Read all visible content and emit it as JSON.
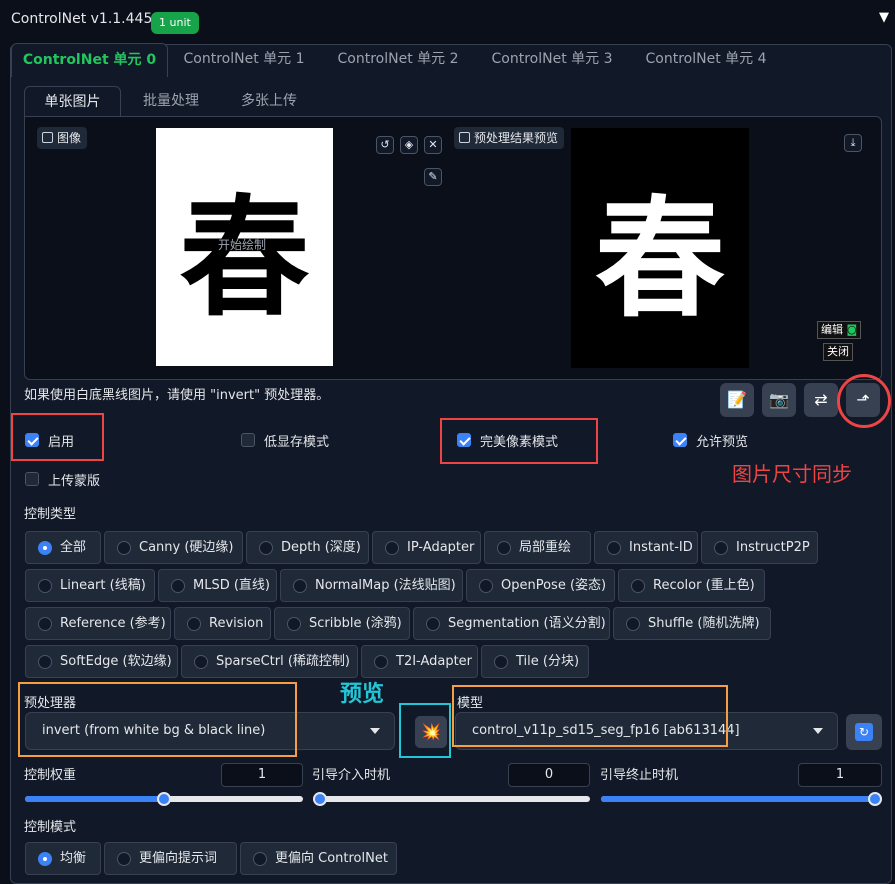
{
  "header": {
    "title": "ControlNet v1.1.445",
    "badge": "1 unit",
    "collapse_icon": "▼"
  },
  "unit_tabs": [
    "ControlNet 单元 0",
    "ControlNet 单元 1",
    "ControlNet 单元 2",
    "ControlNet 单元 3",
    "ControlNet 单元 4"
  ],
  "image_tabs": [
    "单张图片",
    "批量处理",
    "多张上传"
  ],
  "image_panel": {
    "input_label": "图像",
    "canvas_hint": "开始绘制",
    "glyph": "春",
    "preview_label": "预处理结果预览",
    "edit_button": "编辑",
    "close_button": "关闭"
  },
  "hint": "如果使用白底黑线图片，请使用 \"invert\" 预处理器。",
  "checkboxes": {
    "enable": {
      "label": "启用",
      "checked": true
    },
    "low_vram": {
      "label": "低显存模式",
      "checked": false
    },
    "pixel_perfect": {
      "label": "完美像素模式",
      "checked": true
    },
    "allow_preview": {
      "label": "允许预览",
      "checked": true
    },
    "upload_mask": {
      "label": "上传蒙版",
      "checked": false
    }
  },
  "annotations": {
    "size_sync": "图片尺寸同步",
    "preview": "预览"
  },
  "control_type": {
    "label": "控制类型",
    "options": [
      "全部",
      "Canny (硬边缘)",
      "Depth (深度)",
      "IP-Adapter",
      "局部重绘",
      "Instant-ID",
      "InstructP2P",
      "Lineart (线稿)",
      "MLSD (直线)",
      "NormalMap (法线贴图)",
      "OpenPose (姿态)",
      "Recolor (重上色)",
      "Reference (参考)",
      "Revision",
      "Scribble (涂鸦)",
      "Segmentation (语义分割)",
      "Shuffle (随机洗牌)",
      "SoftEdge (软边缘)",
      "SparseCtrl (稀疏控制)",
      "T2I-Adapter",
      "Tile (分块)"
    ],
    "selected": "全部"
  },
  "preprocessor": {
    "label": "预处理器",
    "value": "invert (from white bg & black line)"
  },
  "model": {
    "label": "模型",
    "value": "control_v11p_sd15_seg_fp16 [ab613144]"
  },
  "weights": {
    "control_weight": {
      "label": "控制权重",
      "value": "1",
      "fraction": 0.5
    },
    "start": {
      "label": "引导介入时机",
      "value": "0",
      "fraction": 0.0
    },
    "end": {
      "label": "引导终止时机",
      "value": "1",
      "fraction": 1.0
    }
  },
  "control_mode": {
    "label": "控制模式",
    "options": [
      "均衡",
      "更偏向提示词",
      "更偏向 ControlNet"
    ],
    "selected": "均衡"
  },
  "colors": {
    "accent": "#3b82f6",
    "active_tab": "#22c55e",
    "annotation_red": "#ef4444",
    "annotation_orange": "#f59e42",
    "annotation_cyan": "#22c6d6"
  }
}
